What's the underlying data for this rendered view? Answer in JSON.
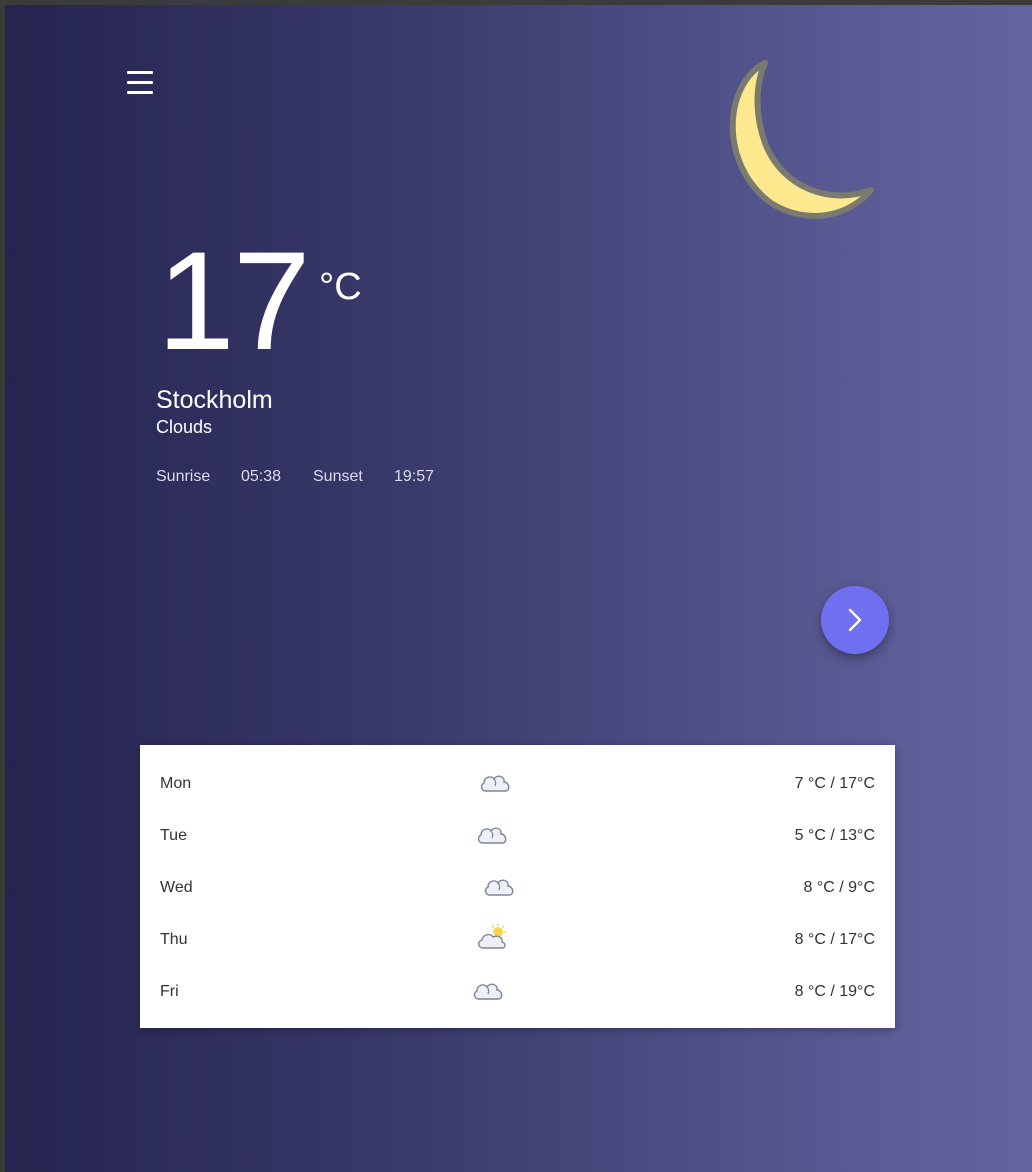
{
  "current": {
    "temperature": "17",
    "unit": "°C",
    "city": "Stockholm",
    "condition": "Clouds",
    "sunrise_label": "Sunrise",
    "sunrise_time": "05:38",
    "sunset_label": "Sunset",
    "sunset_time": "19:57",
    "night_icon": "crescent-moon-icon"
  },
  "colors": {
    "gradient_start": "#25244f",
    "gradient_end": "#6464a0",
    "accent_button": "#6f70f0",
    "moon": "#fde98d"
  },
  "forecast": [
    {
      "day": "Mon",
      "icon": "cloud-icon",
      "range": "7 °C / 17°C"
    },
    {
      "day": "Tue",
      "icon": "cloud-icon",
      "range": "5 °C / 13°C"
    },
    {
      "day": "Wed",
      "icon": "cloud-icon",
      "range": "8 °C / 9°C"
    },
    {
      "day": "Thu",
      "icon": "partly-cloudy-icon",
      "range": "8 °C / 17°C"
    },
    {
      "day": "Fri",
      "icon": "cloud-icon",
      "range": "8 °C / 19°C"
    }
  ]
}
